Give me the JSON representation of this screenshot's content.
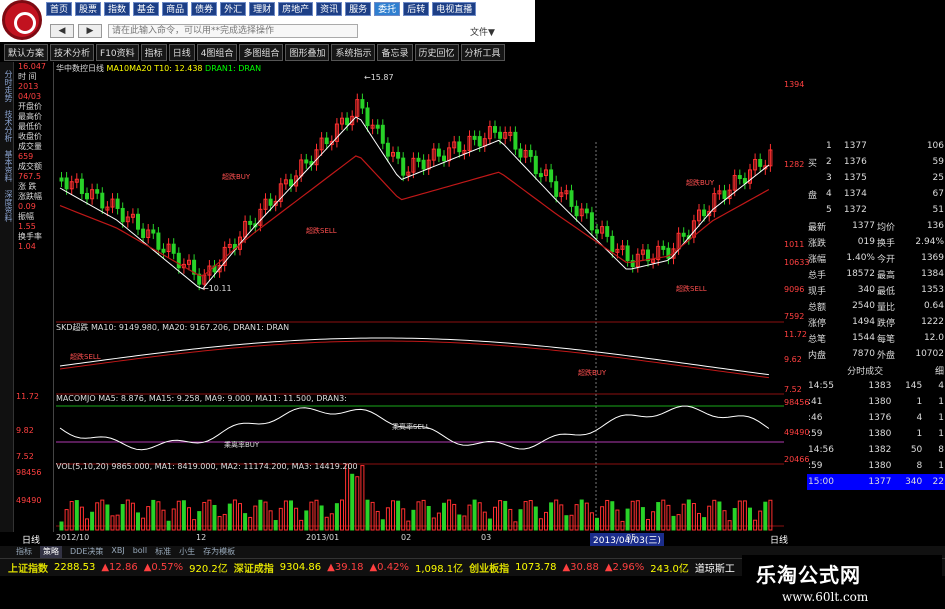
{
  "nav": [
    "首页",
    "股票",
    "指数",
    "基金",
    "商品",
    "债券",
    "外汇",
    "理财",
    "房地产",
    "资讯",
    "服务",
    "委托",
    "后转",
    "电视直播"
  ],
  "toolbar": {
    "back": "◀",
    "forward": "▶",
    "placeholder": "请在此输入命令，可以用**完成选择操作",
    "file_menu": "文件▼"
  },
  "menu3": [
    "默认方案",
    "技术分析",
    "F10资料",
    "指标",
    "日线",
    "4图组合",
    "多图组合",
    "图形叠加",
    "系统指示",
    "备忘录",
    "历史回忆",
    "分析工具"
  ],
  "lefttabs": [
    "分时走势",
    "技术分析",
    "基本资料",
    "深度资料"
  ],
  "info": {
    "price_top": "16.047",
    "labels": [
      {
        "l": "时 间",
        "v": "2013"
      },
      {
        "l": "",
        "v": "04/03"
      },
      {
        "l": "开盘价",
        "v": ""
      },
      {
        "l": "最高价",
        "v": ""
      },
      {
        "l": "最低价",
        "v": ""
      },
      {
        "l": "收盘价",
        "v": ""
      },
      {
        "l": "成交量",
        "v": "659"
      },
      {
        "l": "成交额",
        "v": "767.5"
      },
      {
        "l": "涨 跌",
        "v": ""
      },
      {
        "l": "涨跌幅",
        "v": "0.09"
      },
      {
        "l": "振幅",
        "v": "1.55"
      },
      {
        "l": "换手率",
        "v": "1.04"
      }
    ]
  },
  "main_title": {
    "stock": "华中数控日线",
    "ma": "MA10MA20",
    "t10": "T10: 12.438",
    "dran": "DRAN1: DRAN"
  },
  "annotations": {
    "high": "←15.87",
    "low": "←10.11",
    "buy1": "超跌BUY",
    "buy2": "超跌BUY",
    "sell1": "超跌SELL",
    "sell2": "超跌SELL"
  },
  "sub1": {
    "title": "SKD超跌 MA10: 9149.980, MA20: 9167.206, DRAN1: DRAN",
    "sell": "超跌SELL",
    "buy": "超跌BUY"
  },
  "sub2": {
    "title": "MACOMJO MA5: 8.876, MA15: 9.258, MA9: 9.000, MA11: 11.500, DRAN3:",
    "buy": "乘离率BUY",
    "sell": "乘离率SELL"
  },
  "sub3": {
    "title": "VOL(5,10,20) 9865.000, MA1: 8419.000, MA2: 11174.200, MA3: 14419.200"
  },
  "axis_right": [
    "1394",
    "1282",
    "1011",
    "10633",
    "9096",
    "7592",
    "11.72",
    "9.62",
    "7.52",
    "98456",
    "49490",
    "20466"
  ],
  "axis_left": [
    "11.72",
    "9.82",
    "7.52",
    "98456",
    "49490"
  ],
  "date_marker": "2013/04/03(三)",
  "x_dates": [
    "2012/10",
    "12",
    "2013/01",
    "02",
    "03",
    "05"
  ],
  "side": {
    "buy_label": "买",
    "pan_label": "盘",
    "book": [
      {
        "n": "1",
        "p": "1377",
        "v": "106"
      },
      {
        "n": "2",
        "p": "1376",
        "v": "59"
      },
      {
        "n": "3",
        "p": "1375",
        "v": "25"
      },
      {
        "n": "4",
        "p": "1374",
        "v": "67"
      },
      {
        "n": "5",
        "p": "1372",
        "v": "51"
      }
    ],
    "stats": [
      [
        "最新",
        "1377",
        "均价",
        "136"
      ],
      [
        "涨跌",
        "019",
        "换手",
        "2.94%"
      ],
      [
        "涨幅",
        "1.40%",
        "今开",
        "1369"
      ],
      [
        "总手",
        "18572",
        "最高",
        "1384"
      ],
      [
        "现手",
        "340",
        "最低",
        "1353"
      ],
      [
        "总额",
        "2540",
        "量比",
        "0.64"
      ],
      [
        "涨停",
        "1494",
        "跌停",
        "1222"
      ],
      [
        "总笔",
        "1544",
        "每笔",
        "12.0"
      ],
      [
        "内盘",
        "7870",
        "外盘",
        "10702"
      ]
    ],
    "ticks_head": "分时成交",
    "ticks_head2": "细",
    "ticks": [
      [
        "14:55",
        "1383",
        "145",
        "4"
      ],
      [
        ":41",
        "1380",
        "1",
        "1"
      ],
      [
        ":46",
        "1376",
        "4",
        "1"
      ],
      [
        ":59",
        "1380",
        "1",
        "1"
      ],
      [
        "14:56",
        "1382",
        "50",
        "8"
      ],
      [
        ":59",
        "1380",
        "8",
        "1"
      ],
      [
        "15:00",
        "1377",
        "340",
        "22"
      ]
    ]
  },
  "bottomtabs": [
    "指标",
    "策略",
    "DDE决策",
    "XBJ",
    "boll",
    "标准",
    "小生",
    "存为模板"
  ],
  "ticker": {
    "sh_lbl": "上证指数",
    "sh": "2288.53",
    "sh_ch": "▲12.86",
    "sh_pct": "▲0.57%",
    "sh_amt": "920.2亿",
    "sz_lbl": "深证成指",
    "sz": "9304.86",
    "sz_ch": "▲39.18",
    "sz_pct": "▲0.42%",
    "sz_amt": "1,098.1亿",
    "cy_lbl": "创业板指",
    "cy": "1073.78",
    "cy_ch": "▲30.88",
    "cy_pct": "▲2.96%",
    "cy_amt": "243.0亿",
    "more": "道琼斯工"
  },
  "watermark": {
    "cn": "乐淘公式网",
    "url": "www.60lt.com"
  },
  "chart_data": {
    "type": "candlestick",
    "x": [
      "2012/10",
      "12",
      "2013/01",
      "02",
      "03",
      "04/03",
      "05"
    ],
    "price_high": 15.87,
    "price_low": 10.11
  },
  "colors": {
    "up": "#ff3030",
    "down": "#28d228",
    "ma1": "#ffffff",
    "ma2": "#c01818"
  }
}
